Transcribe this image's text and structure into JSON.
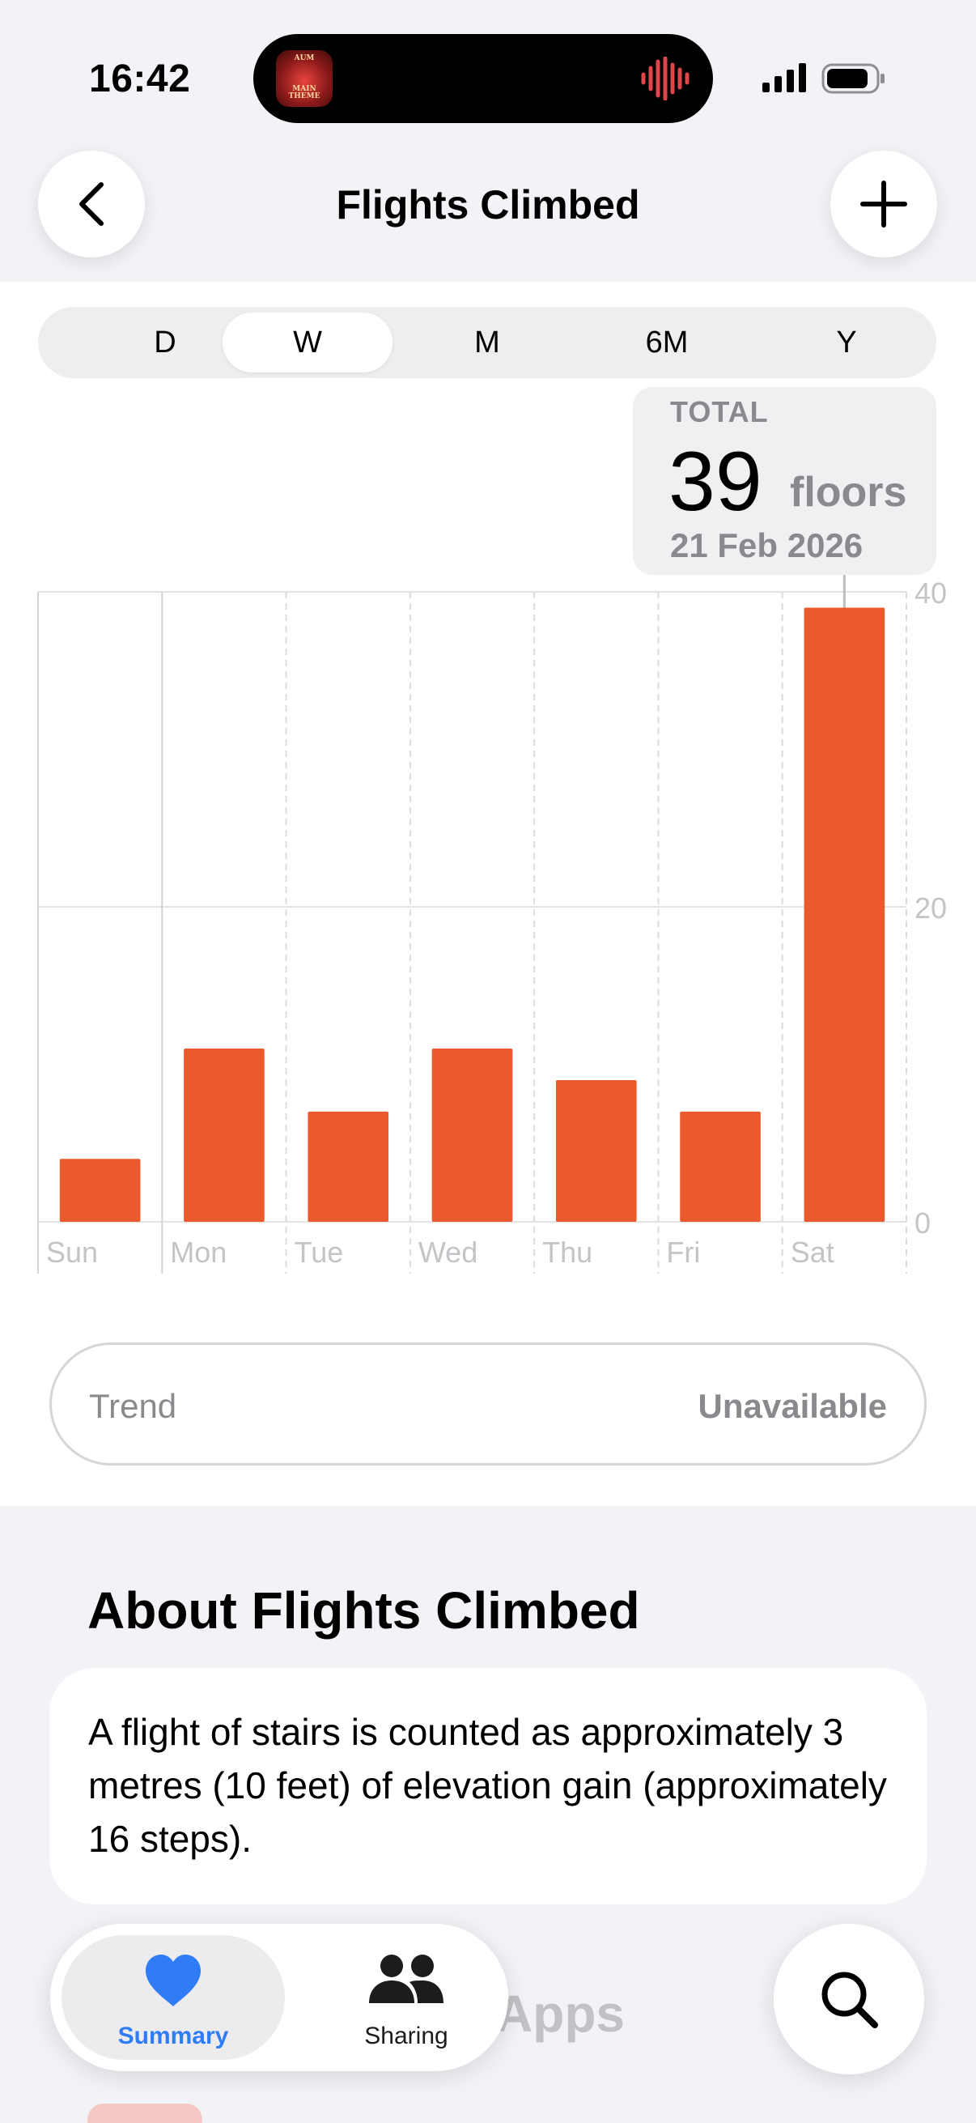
{
  "status_bar": {
    "time": "16:42",
    "now_playing_art_text": [
      "AUM",
      "MAIN THEME"
    ]
  },
  "header": {
    "title": "Flights Climbed",
    "back_icon": "chevron-left-icon",
    "add_icon": "plus-icon"
  },
  "range_selector": {
    "options": [
      "D",
      "W",
      "M",
      "6M",
      "Y"
    ],
    "selected": "W"
  },
  "selection_card": {
    "label": "TOTAL",
    "value": "39",
    "unit": "floors",
    "date": "21 Feb 2026"
  },
  "chart_data": {
    "type": "bar",
    "categories": [
      "Sun",
      "Mon",
      "Tue",
      "Wed",
      "Thu",
      "Fri",
      "Sat"
    ],
    "values": [
      4,
      11,
      7,
      11,
      9,
      7,
      39
    ],
    "y_ticks": [
      "0",
      "20",
      "40"
    ],
    "ylim": [
      0,
      40
    ],
    "bar_color": "#eb5a2d",
    "highlighted": "Sat"
  },
  "trend": {
    "label": "Trend",
    "value": "Unavailable"
  },
  "about": {
    "title": "About Flights Climbed",
    "text": "A flight of stairs is counted as approximately 3 metres (10 feet) of elevation gain (approximately 16 steps)."
  },
  "apps_section_partial": "Apps",
  "tab_bar": {
    "tabs": [
      {
        "label": "Summary",
        "icon": "heart-icon",
        "selected": true
      },
      {
        "label": "Sharing",
        "icon": "people-icon",
        "selected": false
      }
    ],
    "search_icon": "search-icon"
  },
  "colors": {
    "accent": "#2f7cf6",
    "bar": "#eb5a2d",
    "secondary_text": "#8a8a8e"
  }
}
